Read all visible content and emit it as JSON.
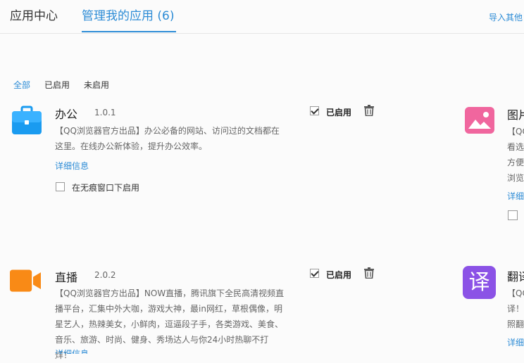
{
  "header": {
    "tab_center": "应用中心",
    "tab_manage": "管理我的应用 (6)",
    "import_link": "导入其他"
  },
  "filters": [
    "全部",
    "已启用",
    "未启用"
  ],
  "apps": [
    {
      "name": "办公",
      "version": "1.0.1",
      "desc": "【QQ浏览器官方出品】办公必备的网站、访问过的文档都在这里。在线办公新体验，提升办公效率。",
      "detail": "详细信息",
      "incognito_label": "在无痕窗口下启用",
      "enabled_label": "已启用",
      "icon": "briefcase-icon",
      "color": "#1a9bf0"
    },
    {
      "name": "直播",
      "version": "2.0.2",
      "desc": "【QQ浏览器官方出品】NOW直播，腾讯旗下全民高清视频直播平台，汇集中外大咖，游戏大神，最in网红，草根偶像，明星艺人，热辣美女，小鲜肉，逗逼段子手，各类游戏、美食、音乐、旅游、时尚、健身、秀场达人与你24小时热聊不打烊！",
      "detail": "详细信息",
      "enabled_label": "已启用",
      "icon": "video-camera-icon",
      "color": "#f98a16"
    }
  ],
  "right_apps": [
    {
      "name_partial": "图片",
      "lines": [
        "【QQ",
        "看选",
        "方便",
        "浏览"
      ],
      "detail_partial": "详细",
      "icon": "picture-icon",
      "color": "#f0669e"
    },
    {
      "name_partial": "翻译",
      "lines": [
        "【QQ",
        "译！",
        "照翻"
      ],
      "detail_partial": "详细",
      "icon_glyph": "译",
      "icon": "translate-icon",
      "color": "#8b52e6"
    }
  ]
}
